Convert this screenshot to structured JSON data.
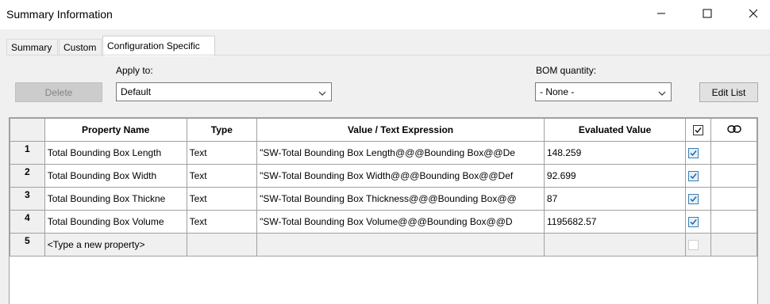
{
  "window": {
    "title": "Summary Information"
  },
  "tabs": [
    {
      "label": "Summary"
    },
    {
      "label": "Custom"
    },
    {
      "label": "Configuration Specific"
    }
  ],
  "toolbar": {
    "delete_label": "Delete",
    "apply_label": "Apply to:",
    "apply_value": "Default",
    "bom_label": "BOM quantity:",
    "bom_value": "- None -",
    "edit_list_label": "Edit List"
  },
  "table": {
    "headers": [
      "Property Name",
      "Type",
      "Value / Text Expression",
      "Evaluated Value"
    ],
    "rows": [
      {
        "num": "1",
        "name": "Total Bounding Box Length",
        "type": "Text",
        "expr": "\"SW-Total Bounding Box Length@@@Bounding Box@@De",
        "value": "148.259",
        "checked": true
      },
      {
        "num": "2",
        "name": "Total Bounding Box Width",
        "type": "Text",
        "expr": "\"SW-Total Bounding Box Width@@@Bounding Box@@Def",
        "value": "92.699",
        "checked": true
      },
      {
        "num": "3",
        "name": "Total Bounding Box Thickne",
        "type": "Text",
        "expr": "\"SW-Total Bounding Box Thickness@@@Bounding Box@@",
        "value": "87",
        "checked": true
      },
      {
        "num": "4",
        "name": "Total Bounding Box Volume",
        "type": "Text",
        "expr": "\"SW-Total Bounding Box Volume@@@Bounding Box@@D",
        "value": "1195682.57",
        "checked": true
      },
      {
        "num": "5",
        "name": "<Type a new property>",
        "type": "",
        "expr": "",
        "value": "",
        "checked": false
      }
    ]
  },
  "colors": {
    "accent": "#3c7fb1",
    "panel": "#f0f0f0",
    "grid_line": "#a0a0a0"
  }
}
